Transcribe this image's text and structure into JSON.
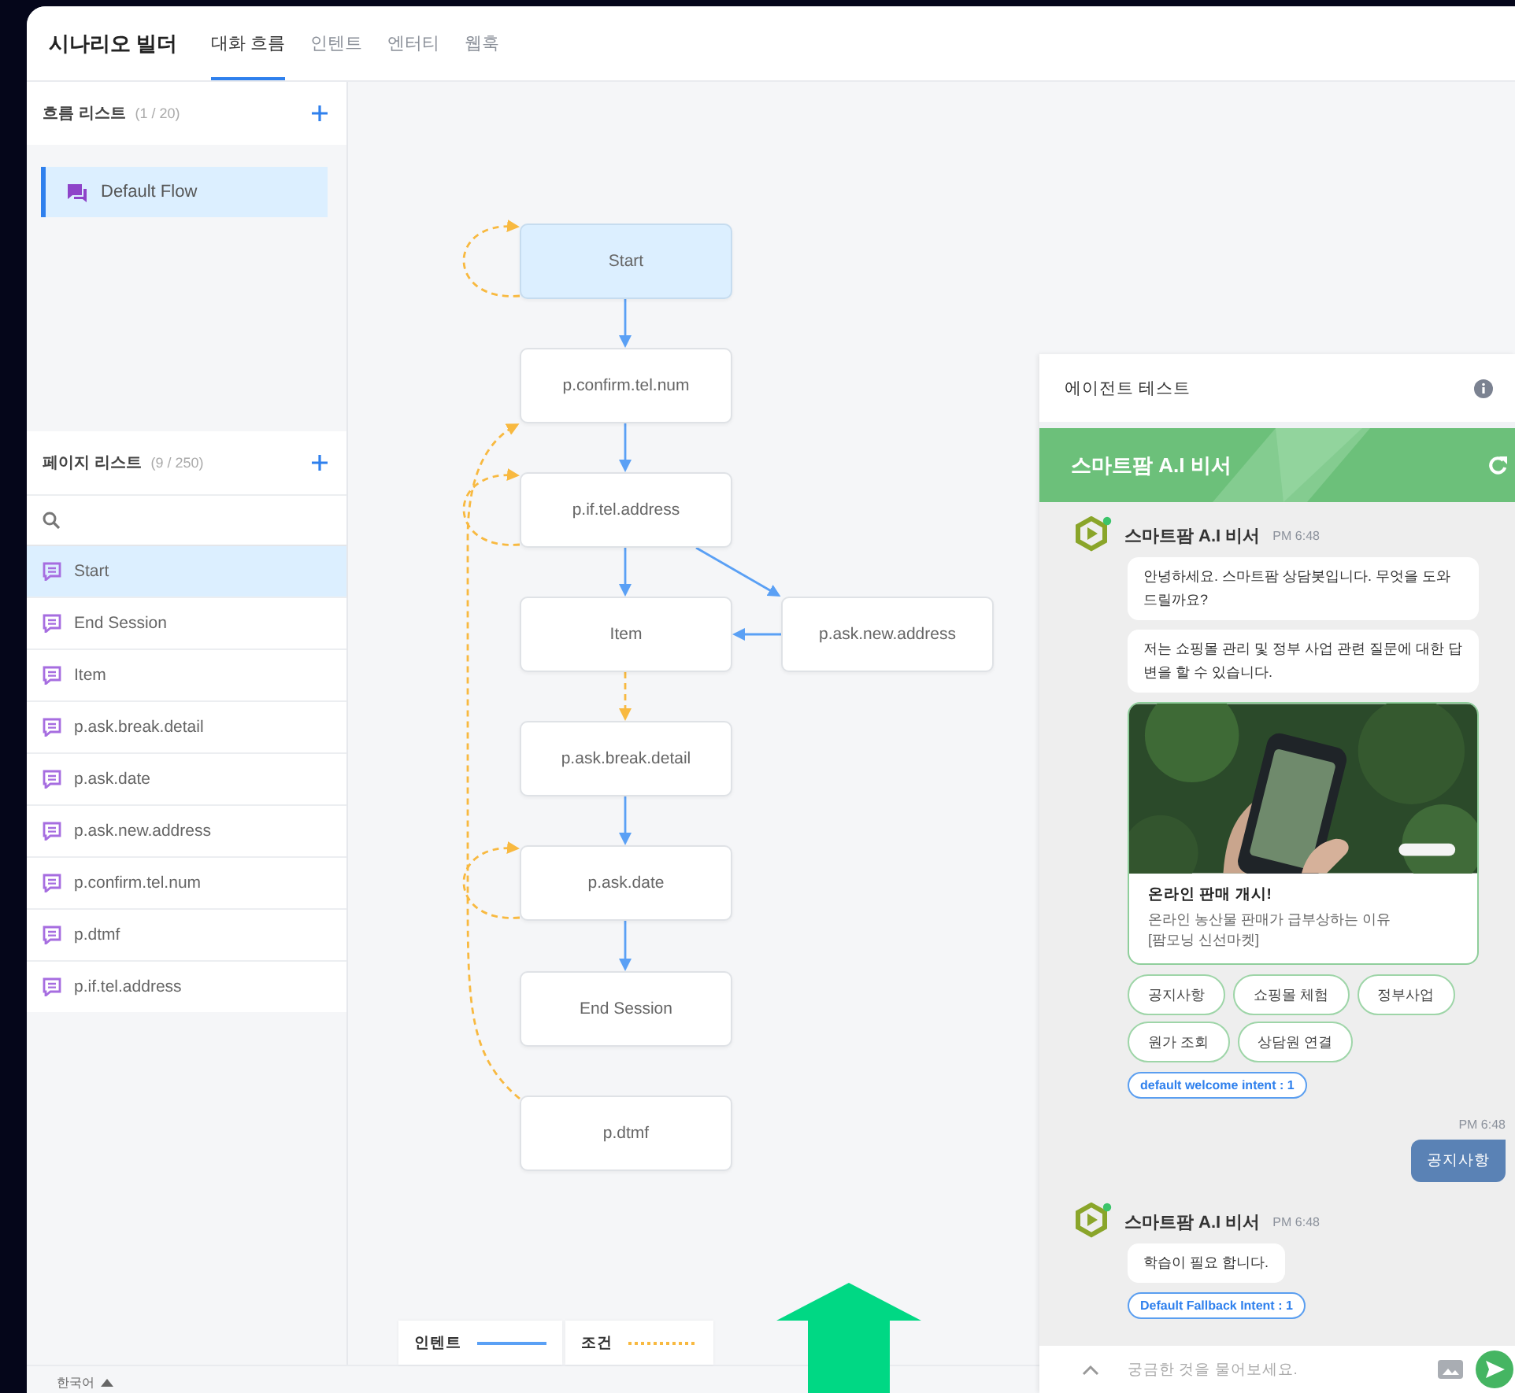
{
  "header": {
    "title": "시나리오 빌더",
    "tabs": [
      {
        "label": "대화 흐름",
        "selected": true
      },
      {
        "label": "인텐트",
        "selected": false
      },
      {
        "label": "엔터티",
        "selected": false
      },
      {
        "label": "웹훅",
        "selected": false
      }
    ]
  },
  "flow_list": {
    "title": "흐름 리스트",
    "count": "(1 / 20)",
    "items": [
      {
        "label": "Default Flow",
        "selected": true
      }
    ]
  },
  "page_list": {
    "title": "페이지 리스트",
    "count": "(9 / 250)",
    "items": [
      {
        "label": "Start",
        "selected": true
      },
      {
        "label": "End Session",
        "selected": false
      },
      {
        "label": "Item",
        "selected": false
      },
      {
        "label": "p.ask.break.detail",
        "selected": false
      },
      {
        "label": "p.ask.date",
        "selected": false
      },
      {
        "label": "p.ask.new.address",
        "selected": false
      },
      {
        "label": "p.confirm.tel.num",
        "selected": false
      },
      {
        "label": "p.dtmf",
        "selected": false
      },
      {
        "label": "p.if.tel.address",
        "selected": false
      }
    ]
  },
  "canvas": {
    "nodes": [
      {
        "label": "Start",
        "selected": true
      },
      {
        "label": "p.confirm.tel.num",
        "selected": false
      },
      {
        "label": "p.if.tel.address",
        "selected": false
      },
      {
        "label": "Item",
        "selected": false
      },
      {
        "label": "p.ask.new.address",
        "selected": false
      },
      {
        "label": "p.ask.break.detail",
        "selected": false
      },
      {
        "label": "p.ask.date",
        "selected": false
      },
      {
        "label": "End Session",
        "selected": false
      },
      {
        "label": "p.dtmf",
        "selected": false
      }
    ],
    "edges": [
      {
        "kind": "intent"
      },
      {
        "kind": "intent"
      },
      {
        "kind": "intent"
      },
      {
        "kind": "intent"
      },
      {
        "kind": "intent"
      },
      {
        "kind": "condition"
      },
      {
        "kind": "intent"
      },
      {
        "kind": "intent"
      },
      {
        "kind": "condition"
      },
      {
        "kind": "condition"
      },
      {
        "kind": "condition"
      },
      {
        "kind": "condition"
      }
    ],
    "legend": [
      {
        "label": "인텐트",
        "kind": "intent"
      },
      {
        "label": "조건",
        "kind": "condition"
      }
    ]
  },
  "agent_test": {
    "title": "에이전트 테스트",
    "bot_name": "스마트팜 A.I 비서",
    "messages": [
      {
        "kind": "bot",
        "sender": "스마트팜 A.I 비서",
        "time": "PM 6:48",
        "bubbles": [
          "안녕하세요. 스마트팜 상담봇입니다. 무엇을 도와드릴까요?",
          "저는 쇼핑몰 관리 및 정부 사업 관련 질문에 대한 답변을 할 수 있습니다."
        ],
        "card": {
          "kind": "picture",
          "title": "온라인 판매 개시!",
          "lines": [
            "온라인 농산물 판매가 급부상하는 이유",
            "[팜모닝 신선마켓]"
          ]
        },
        "quick_replies": [
          "공지사항",
          "쇼핑몰 체험",
          "정부사업",
          "원가 조회",
          "상담원 연결"
        ],
        "intent": "default welcome intent : 1"
      },
      {
        "kind": "user",
        "time": "PM 6:48",
        "text": "공지사항"
      },
      {
        "kind": "bot",
        "sender": "스마트팜 A.I 비서",
        "time": "PM 6:48",
        "bubbles": [
          "학습이 필요 합니다."
        ],
        "intent": "Default Fallback Intent : 1"
      }
    ],
    "input": {
      "placeholder": "궁금한 것을 물어보세요."
    }
  },
  "footer": {
    "language": "한국어"
  }
}
